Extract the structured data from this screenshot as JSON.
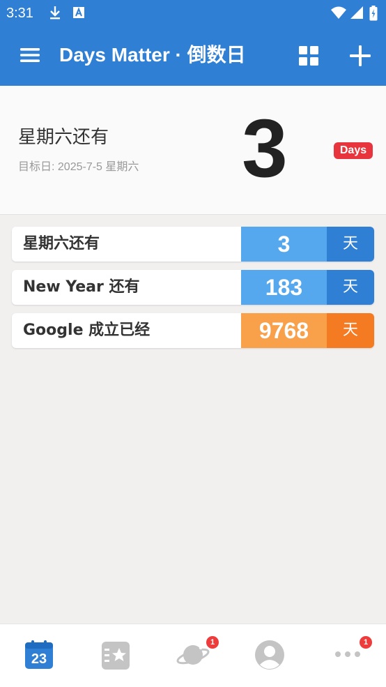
{
  "status_bar": {
    "time": "3:31"
  },
  "app_bar": {
    "title": "Days Matter · 倒数日"
  },
  "featured": {
    "title": "星期六还有",
    "subtitle": "目标日: 2025-7-5 星期六",
    "count": "3",
    "badge": "Days"
  },
  "events": [
    {
      "label": "星期六还有",
      "count": "3",
      "unit": "天",
      "color": "#55a8ee"
    },
    {
      "label": "New Year 还有",
      "count": "183",
      "unit": "天",
      "color": "#55a8ee"
    },
    {
      "label": "Google 成立已经",
      "count": "9768",
      "unit": "天",
      "color": "#f9a04a"
    }
  ],
  "bottom_nav": {
    "calendar_day": "23",
    "planet_badge": "1",
    "more_badge": "1"
  },
  "colors": {
    "primary": "#2f7fd4",
    "accent_light": "#55a8ee",
    "orange": "#f9a04a",
    "orange_dark": "#f47b22",
    "badge_red": "#e8353d"
  }
}
